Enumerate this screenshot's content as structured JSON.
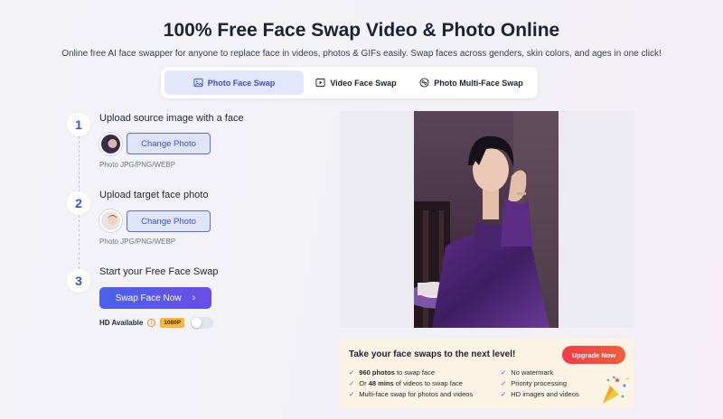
{
  "header": {
    "title": "100% Free Face Swap Video & Photo Online",
    "subtitle": "Online free AI face swapper for anyone to replace face in videos, photos & GIFs easily. Swap faces across genders, skin colors, and ages in one click!"
  },
  "tabs": [
    {
      "label": "Photo Face Swap",
      "icon": "image-icon",
      "active": true
    },
    {
      "label": "Video Face Swap",
      "icon": "video-icon",
      "active": false
    },
    {
      "label": "Photo Multi-Face Swap",
      "icon": "multi-face-icon",
      "active": false
    }
  ],
  "steps": [
    {
      "number": "1",
      "title": "Upload source image with a face",
      "button": "Change Photo",
      "hint": "Photo JPG/PNG/WEBP"
    },
    {
      "number": "2",
      "title": "Upload target face photo",
      "button": "Change Photo",
      "hint": "Photo JPG/PNG/WEBP"
    },
    {
      "number": "3",
      "title": "Start your Free Face Swap",
      "button": "Swap Face Now"
    }
  ],
  "hd": {
    "label": "HD Available",
    "badge": "1080P",
    "enabled": false
  },
  "promo": {
    "title": "Take your face swaps to the next level!",
    "upgrade_label": "Upgrade Now",
    "features_left": [
      {
        "bold": "960 photos",
        "text": " to swap face",
        "prefix": ""
      },
      {
        "prefix": "Or ",
        "bold": "48 mins",
        "text": " of videos to swap face"
      },
      {
        "prefix": "",
        "bold": "",
        "text": "Multi-face swap for photos and videos"
      }
    ],
    "features_right": [
      "No watermark",
      "Priority processing",
      "HD images and videos"
    ]
  },
  "colors": {
    "accent": "#3552d8",
    "primary_gradient_start": "#4a62ec",
    "primary_gradient_end": "#6a4de6",
    "upgrade": "#f13c4a",
    "badge": "#f7b73a"
  }
}
